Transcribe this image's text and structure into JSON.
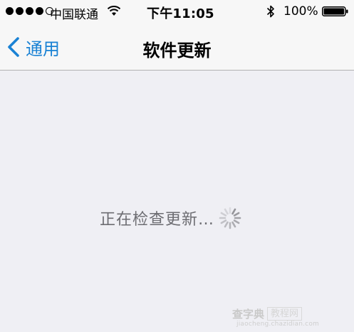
{
  "status_bar": {
    "signal_dots": [
      true,
      true,
      true,
      true,
      false
    ],
    "carrier": "中国联通",
    "time": "下午11:05",
    "battery_percent": "100%",
    "battery_level": 1.0,
    "icons": [
      "wifi-icon",
      "bluetooth-icon",
      "battery-icon"
    ]
  },
  "nav_bar": {
    "back_label": "通用",
    "title": "软件更新",
    "accent_color": "#1a82d4"
  },
  "main": {
    "status_text": "正在检查更新…",
    "activity": "spinner"
  },
  "watermark": {
    "left": "查字典",
    "right": "教程网",
    "url": "jiaocheng.chazidian.com"
  }
}
